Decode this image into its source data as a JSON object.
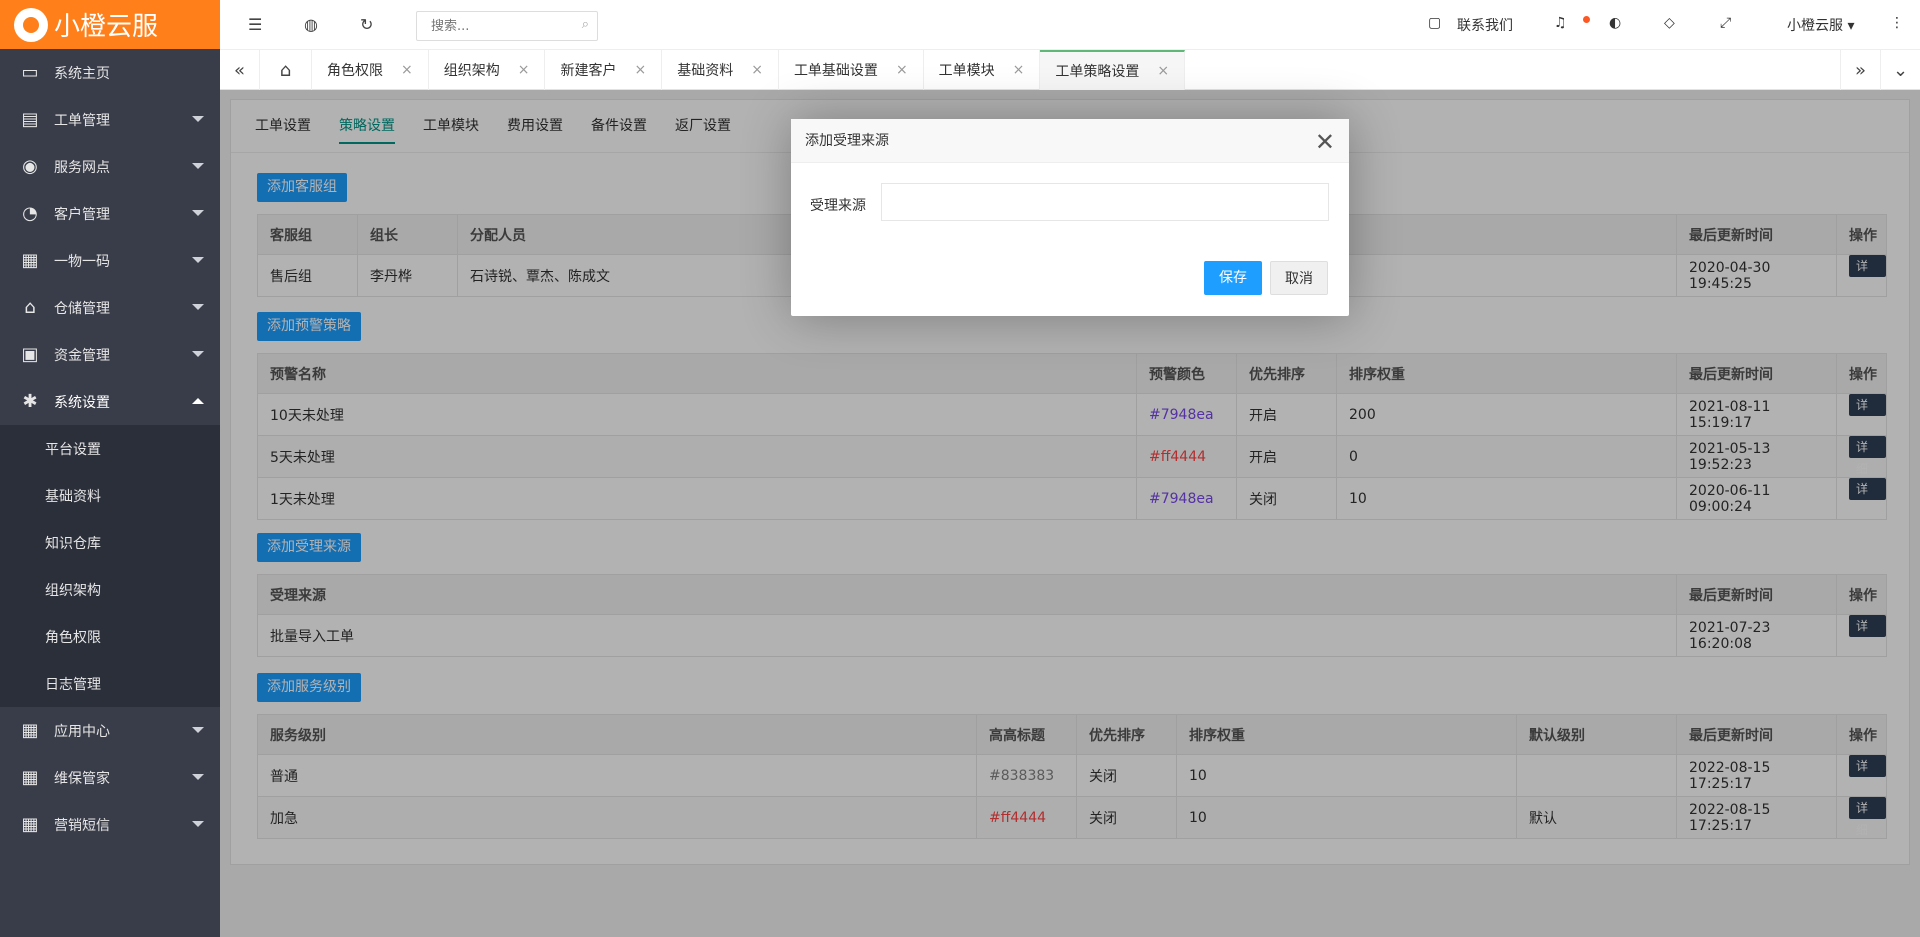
{
  "brand": {
    "name": "小橙云服"
  },
  "sidebar": {
    "items": [
      {
        "label": "系统主页",
        "icon": "monitor-icon",
        "glyph": "▭"
      },
      {
        "label": "工单管理",
        "icon": "document-icon",
        "glyph": "▤"
      },
      {
        "label": "服务网点",
        "icon": "globe-icon",
        "glyph": "◉"
      },
      {
        "label": "客户管理",
        "icon": "user-icon",
        "glyph": "◔"
      },
      {
        "label": "一物一码",
        "icon": "grid-icon",
        "glyph": "▦"
      },
      {
        "label": "仓储管理",
        "icon": "bank-icon",
        "glyph": "⌂"
      },
      {
        "label": "资金管理",
        "icon": "money-icon",
        "glyph": "▣"
      },
      {
        "label": "系统设置",
        "icon": "gear-icon",
        "glyph": "✱"
      },
      {
        "label": "应用中心",
        "icon": "grid-icon",
        "glyph": "▦"
      },
      {
        "label": "维保管家",
        "icon": "grid-icon",
        "glyph": "▦"
      },
      {
        "label": "营销短信",
        "icon": "grid-icon",
        "glyph": "▦"
      }
    ],
    "submenu": [
      "平台设置",
      "基础资料",
      "知识仓库",
      "组织架构",
      "角色权限",
      "日志管理"
    ]
  },
  "header": {
    "search_placeholder": "搜索...",
    "contact": "联系我们",
    "user": "小橙云服"
  },
  "tabs": [
    "角色权限",
    "组织架构",
    "新建客户",
    "基础资料",
    "工单基础设置",
    "工单模块",
    "工单策略设置"
  ],
  "subtabs": [
    "工单设置",
    "策略设置",
    "工单模块",
    "费用设置",
    "备件设置",
    "返厂设置"
  ],
  "sections": {
    "service_group": {
      "button": "添加客服组",
      "headers": [
        "客服组",
        "组长",
        "分配人员",
        "最后更新时间",
        "操作"
      ],
      "rows": [
        [
          "售后组",
          "李丹桦",
          "石诗锐、覃杰、陈成文",
          "2020-04-30 19:45:25",
          "详细"
        ]
      ]
    },
    "warning": {
      "button": "添加预警策略",
      "headers": [
        "预警名称",
        "预警颜色",
        "优先排序",
        "排序权重",
        "最后更新时间",
        "操作"
      ],
      "rows": [
        [
          "10天未处理",
          "#7948ea",
          "开启",
          "200",
          "2021-08-11 15:19:17",
          "详细"
        ],
        [
          "5天未处理",
          "#ff4444",
          "开启",
          "0",
          "2021-05-13 19:52:23",
          "详细"
        ],
        [
          "1天未处理",
          "#7948ea",
          "关闭",
          "10",
          "2020-06-11 09:00:24",
          "详细"
        ]
      ]
    },
    "source": {
      "button": "添加受理来源",
      "headers": [
        "受理来源",
        "最后更新时间",
        "操作"
      ],
      "rows": [
        [
          "批量导入工单",
          "2021-07-23 16:20:08",
          "详细"
        ]
      ]
    },
    "service_level": {
      "button": "添加服务级别",
      "headers": [
        "服务级别",
        "高高标题",
        "优先排序",
        "排序权重",
        "默认级别",
        "最后更新时间",
        "操作"
      ],
      "rows": [
        [
          "普通",
          "#838383",
          "关闭",
          "10",
          "",
          "2022-08-15 17:25:17",
          "详细"
        ],
        [
          "加急",
          "#ff4444",
          "关闭",
          "10",
          "默认",
          "2022-08-15 17:25:17",
          "详细"
        ]
      ]
    }
  },
  "modal": {
    "title": "添加受理来源",
    "field_label": "受理来源",
    "field_value": "",
    "save": "保存",
    "cancel": "取消"
  },
  "colors": {
    "brand": "#ff7f1a",
    "sidebar": "#393d49",
    "primary": "#1e9fff",
    "accent": "#009688"
  }
}
